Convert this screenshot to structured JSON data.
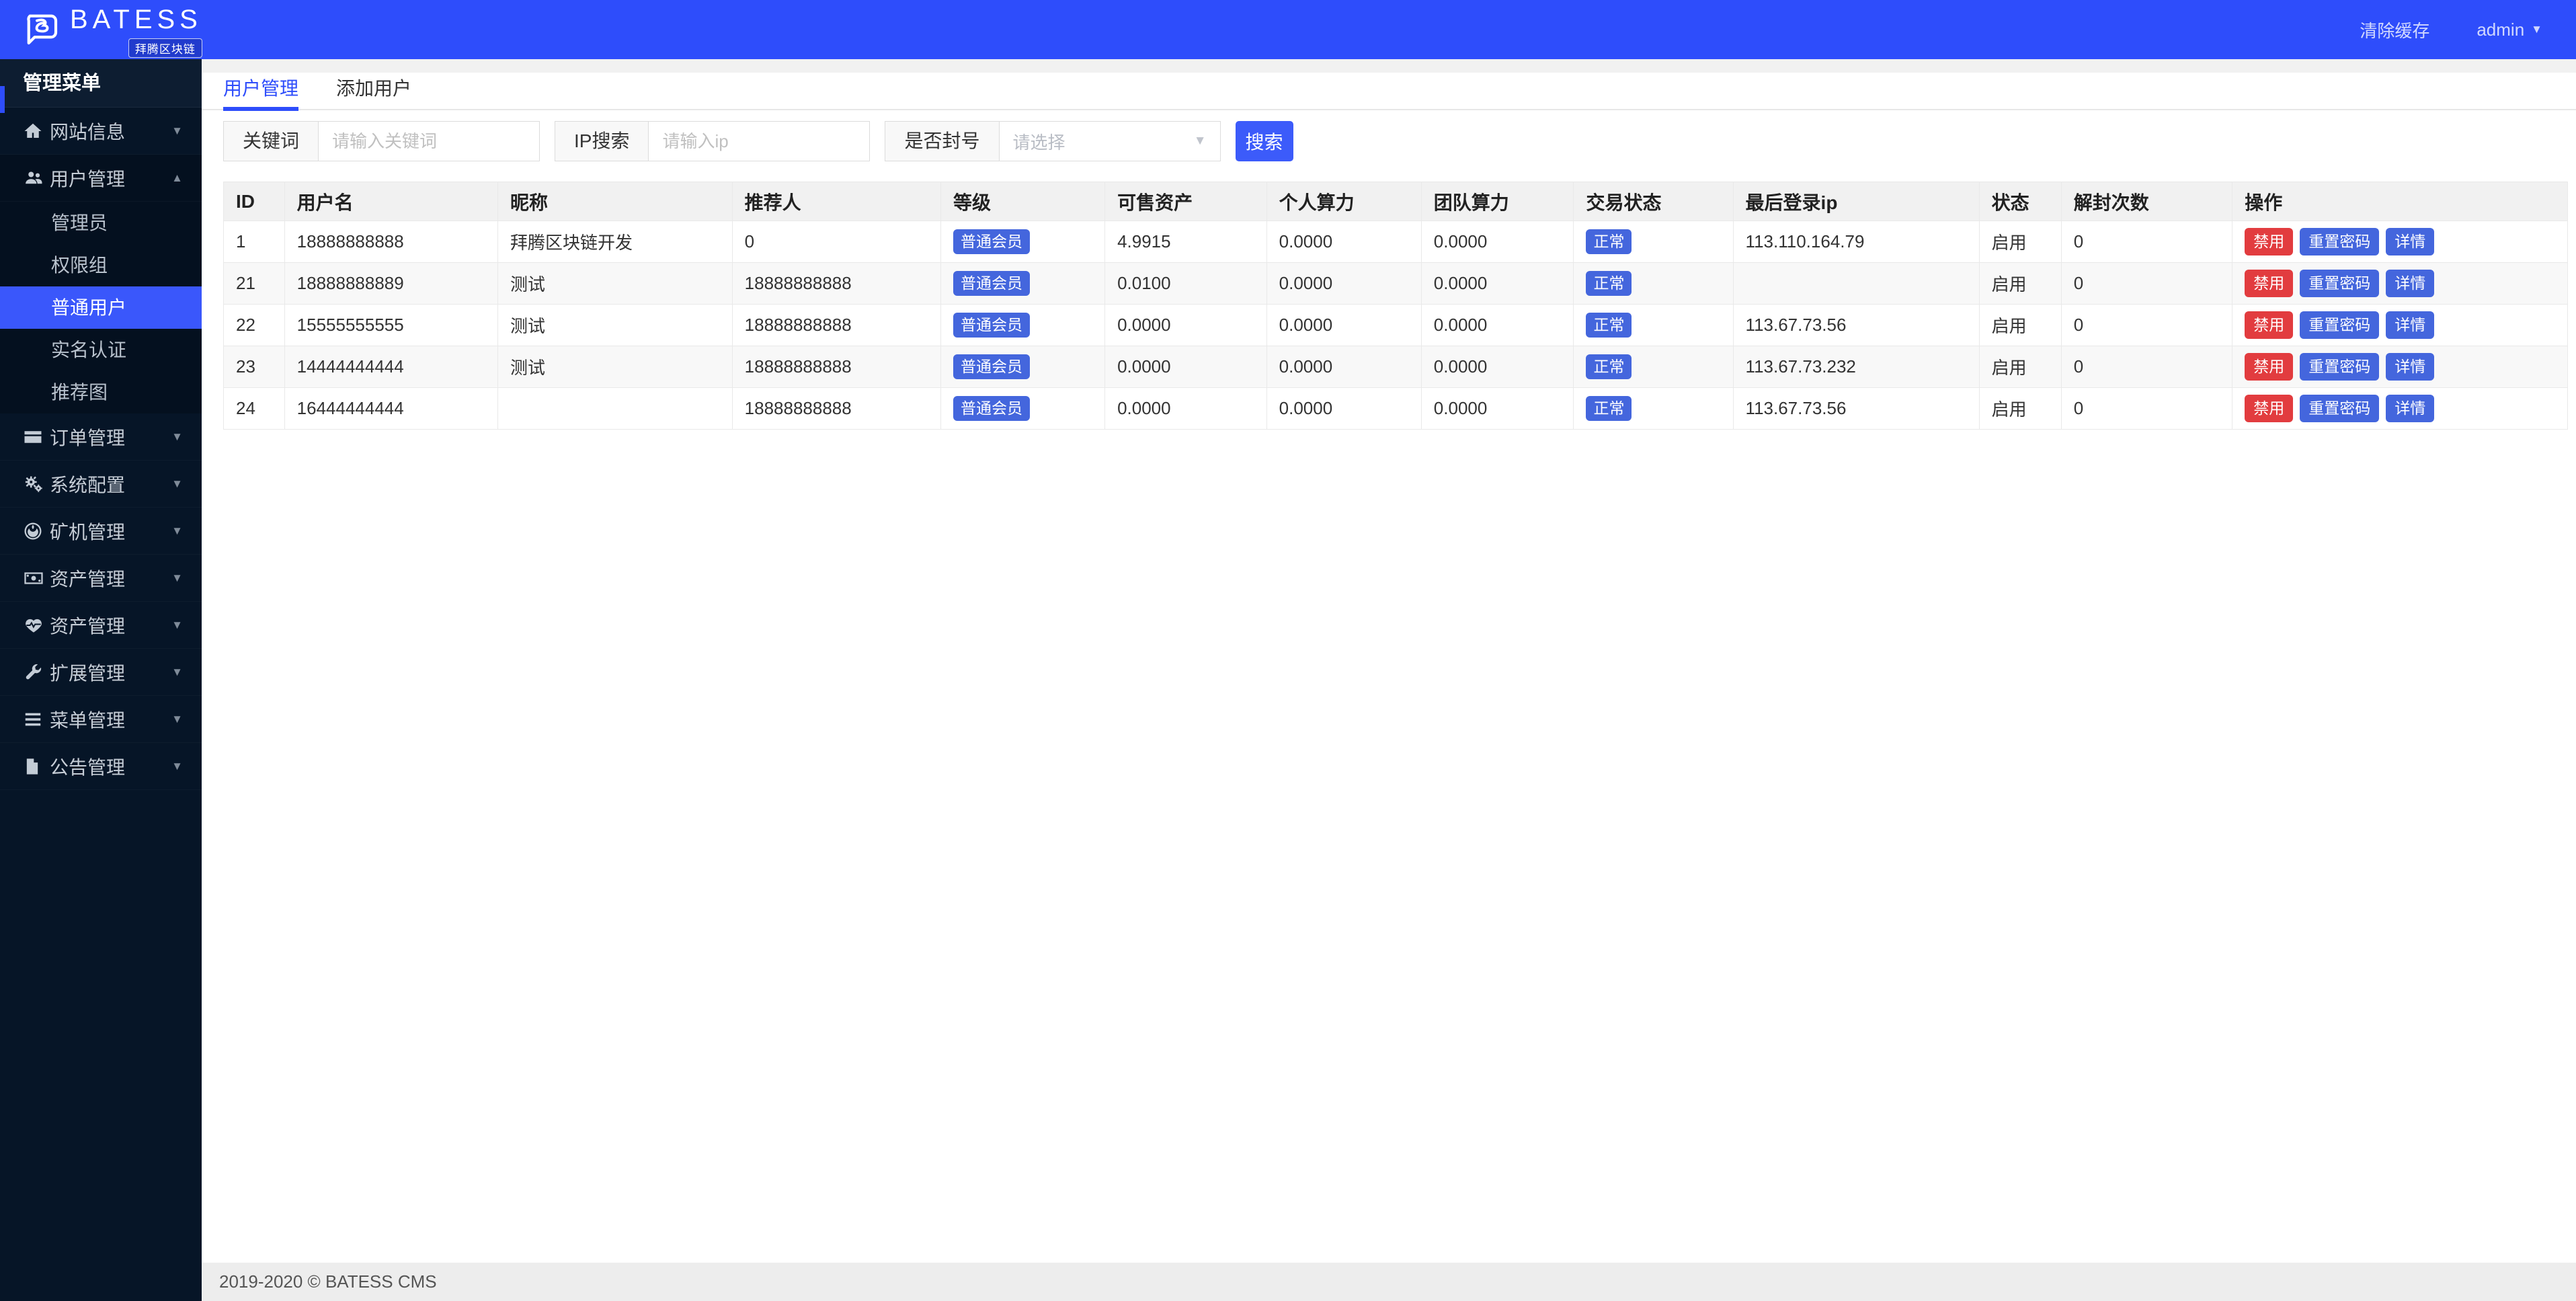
{
  "topbar": {
    "brand": "BATESS",
    "brand_tagline": "拜腾区块链",
    "clear_cache": "清除缓存",
    "user": "admin"
  },
  "sidebar": {
    "header": "管理菜单",
    "items": [
      {
        "name": "site-info",
        "label": "网站信息",
        "icon": "home-icon"
      },
      {
        "name": "user-mgmt",
        "label": "用户管理",
        "icon": "users-icon",
        "expanded": true,
        "children": [
          {
            "label": "管理员",
            "active": false
          },
          {
            "label": "权限组",
            "active": false
          },
          {
            "label": "普通用户",
            "active": true
          },
          {
            "label": "实名认证",
            "active": false
          },
          {
            "label": "推荐图",
            "active": false
          }
        ]
      },
      {
        "name": "order-mgmt",
        "label": "订单管理",
        "icon": "credit-card-icon"
      },
      {
        "name": "system-config",
        "label": "系统配置",
        "icon": "gears-icon"
      },
      {
        "name": "miner-mgmt",
        "label": "矿机管理",
        "icon": "rebel-icon"
      },
      {
        "name": "asset-mgmt-1",
        "label": "资产管理",
        "icon": "money-icon"
      },
      {
        "name": "asset-mgmt-2",
        "label": "资产管理",
        "icon": "heartbeat-icon"
      },
      {
        "name": "extension-mgmt",
        "label": "扩展管理",
        "icon": "wrench-icon"
      },
      {
        "name": "menu-mgmt",
        "label": "菜单管理",
        "icon": "bars-icon"
      },
      {
        "name": "notice-mgmt",
        "label": "公告管理",
        "icon": "file-icon"
      }
    ]
  },
  "tabs": [
    {
      "label": "用户管理",
      "active": true
    },
    {
      "label": "添加用户",
      "active": false
    }
  ],
  "filters": {
    "keyword_label": "关键词",
    "keyword_placeholder": "请输入关键词",
    "ip_label": "IP搜索",
    "ip_placeholder": "请输入ip",
    "ban_label": "是否封号",
    "ban_placeholder": "请选择",
    "search_button": "搜索"
  },
  "table": {
    "columns": [
      "ID",
      "用户名",
      "昵称",
      "推荐人",
      "等级",
      "可售资产",
      "个人算力",
      "团队算力",
      "交易状态",
      "最后登录ip",
      "状态",
      "解封次数",
      "操作"
    ],
    "actions": [
      "禁用",
      "重置密码",
      "详情"
    ],
    "rows": [
      {
        "id": "1",
        "username": "18888888888",
        "nickname": "拜腾区块链开发",
        "referrer": "0",
        "level": "普通会员",
        "sellable": "4.9915",
        "personal_power": "0.0000",
        "team_power": "0.0000",
        "trade_status": "正常",
        "last_ip": "113.110.164.79",
        "status": "启用",
        "unban_count": "0"
      },
      {
        "id": "21",
        "username": "18888888889",
        "nickname": "测试",
        "referrer": "18888888888",
        "level": "普通会员",
        "sellable": "0.0100",
        "personal_power": "0.0000",
        "team_power": "0.0000",
        "trade_status": "正常",
        "last_ip": "",
        "status": "启用",
        "unban_count": "0"
      },
      {
        "id": "22",
        "username": "15555555555",
        "nickname": "测试",
        "referrer": "18888888888",
        "level": "普通会员",
        "sellable": "0.0000",
        "personal_power": "0.0000",
        "team_power": "0.0000",
        "trade_status": "正常",
        "last_ip": "113.67.73.56",
        "status": "启用",
        "unban_count": "0"
      },
      {
        "id": "23",
        "username": "14444444444",
        "nickname": "测试",
        "referrer": "18888888888",
        "level": "普通会员",
        "sellable": "0.0000",
        "personal_power": "0.0000",
        "team_power": "0.0000",
        "trade_status": "正常",
        "last_ip": "113.67.73.232",
        "status": "启用",
        "unban_count": "0"
      },
      {
        "id": "24",
        "username": "16444444444",
        "nickname": "",
        "referrer": "18888888888",
        "level": "普通会员",
        "sellable": "0.0000",
        "personal_power": "0.0000",
        "team_power": "0.0000",
        "trade_status": "正常",
        "last_ip": "113.67.73.56",
        "status": "启用",
        "unban_count": "0"
      }
    ]
  },
  "footer": {
    "copyright": "2019-2020 © BATESS CMS"
  },
  "colors": {
    "topbar_blue": "#2e4dfb",
    "accent_blue": "#3a57fb",
    "badge_blue": "#4466dd",
    "danger_red": "#e23c3f",
    "sidebar_bg": "#061527"
  }
}
